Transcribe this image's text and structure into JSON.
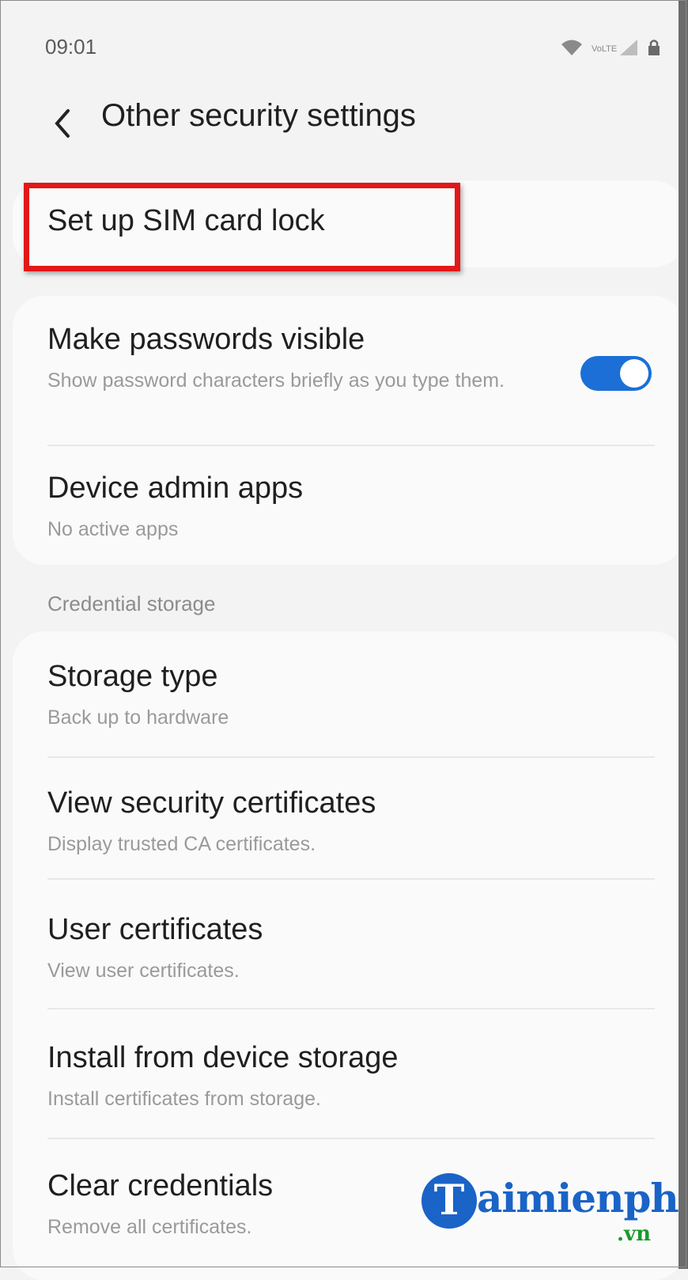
{
  "status_bar": {
    "time": "09:01",
    "icons": [
      "wifi-icon",
      "volte-icon",
      "signal-icon",
      "lock-icon"
    ],
    "volte_label": "VoLTE"
  },
  "header": {
    "back_icon": "chevron-left-icon",
    "title": "Other security settings"
  },
  "items": {
    "sim_lock": {
      "title": "Set up SIM card lock"
    },
    "passwords_visible": {
      "title": "Make passwords visible",
      "subtitle": "Show password characters briefly as you type them.",
      "toggle_on": true
    },
    "device_admin": {
      "title": "Device admin apps",
      "subtitle": "No active apps"
    },
    "section_label": "Credential storage",
    "storage_type": {
      "title": "Storage type",
      "subtitle": "Back up to hardware"
    },
    "view_certs": {
      "title": "View security certificates",
      "subtitle": "Display trusted CA certificates."
    },
    "user_certs": {
      "title": "User certificates",
      "subtitle": "View user certificates."
    },
    "install_storage": {
      "title": "Install from device storage",
      "subtitle": "Install certificates from storage."
    },
    "clear_creds": {
      "title": "Clear credentials",
      "subtitle": "Remove all certificates."
    }
  },
  "watermark": {
    "letter": "T",
    "text": "aimienphi",
    "suffix": ".vn"
  },
  "colors": {
    "accent": "#1b6fd6",
    "highlight": "#e21818",
    "watermark_blue": "#1a63c7",
    "watermark_green": "#1a9a2a"
  }
}
